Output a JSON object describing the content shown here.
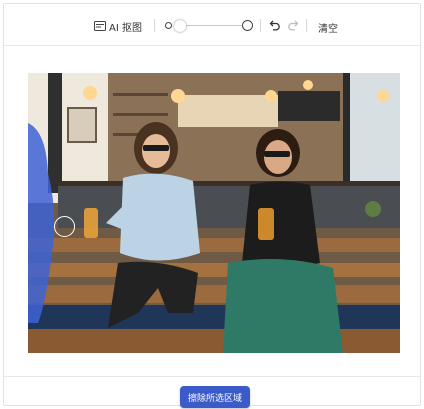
{
  "toolbar": {
    "ai_cutout_label": "AI 抠图",
    "clear_label": "清空"
  },
  "footer": {
    "erase_selection_label": "擦除所选区域"
  },
  "colors": {
    "primary_button": "#3b5bc8",
    "brush_mask": "#3d63d6"
  }
}
